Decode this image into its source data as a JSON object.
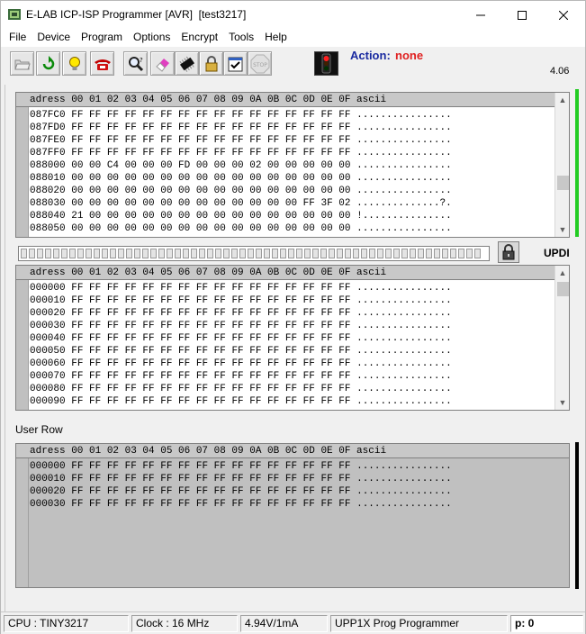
{
  "window": {
    "title": "E-LAB ICP-ISP Programmer [AVR]  [test3217]",
    "minimize_glyph": "—",
    "maximize_glyph": "☐",
    "close_glyph": "✕"
  },
  "menu": [
    "File",
    "Device",
    "Program",
    "Options",
    "Encrypt",
    "Tools",
    "Help"
  ],
  "toolbar": {
    "buttons": [
      {
        "name": "open-icon"
      },
      {
        "name": "reload-icon"
      },
      {
        "name": "bulb-icon"
      },
      {
        "name": "phone-icon"
      },
      {
        "name": "search-icon"
      },
      {
        "name": "eraser-icon"
      },
      {
        "name": "chip-icon"
      },
      {
        "name": "lock-icon"
      },
      {
        "name": "verify-check-icon"
      },
      {
        "name": "stop-icon"
      }
    ],
    "stop_label": "STOP",
    "action_label": "Action:",
    "action_value": "none",
    "version": "4.06"
  },
  "flash_panel": {
    "header": "adress 00 01 02 03 04 05 06 07 08 09 0A 0B 0C 0D 0E 0F ascii",
    "rows": [
      {
        "addr": "087FC0",
        "bytes": "FF FF FF FF FF FF FF FF FF FF FF FF FF FF FF FF",
        "ascii": "................"
      },
      {
        "addr": "087FD0",
        "bytes": "FF FF FF FF FF FF FF FF FF FF FF FF FF FF FF FF",
        "ascii": "................"
      },
      {
        "addr": "087FE0",
        "bytes": "FF FF FF FF FF FF FF FF FF FF FF FF FF FF FF FF",
        "ascii": "................"
      },
      {
        "addr": "087FF0",
        "bytes": "FF FF FF FF FF FF FF FF FF FF FF FF FF FF FF FF",
        "ascii": "................"
      },
      {
        "addr": "088000",
        "bytes": "00 00 C4 00 00 00 FD 00 00 00 02 00 00 00 00 00",
        "ascii": "................"
      },
      {
        "addr": "088010",
        "bytes": "00 00 00 00 00 00 00 00 00 00 00 00 00 00 00 00",
        "ascii": "................"
      },
      {
        "addr": "088020",
        "bytes": "00 00 00 00 00 00 00 00 00 00 00 00 00 00 00 00",
        "ascii": "................"
      },
      {
        "addr": "088030",
        "bytes": "00 00 00 00 00 00 00 00 00 00 00 00 00 FF 3F 02",
        "ascii": "..............?."
      },
      {
        "addr": "088040",
        "bytes": "21 00 00 00 00 00 00 00 00 00 00 00 00 00 00 00",
        "ascii": "!..............."
      },
      {
        "addr": "088050",
        "bytes": "00 00 00 00 00 00 00 00 00 00 00 00 00 00 00 00",
        "ascii": "................"
      }
    ]
  },
  "interface": {
    "label": "UPDI"
  },
  "eeprom_panel": {
    "header": "adress 00 01 02 03 04 05 06 07 08 09 0A 0B 0C 0D 0E 0F ascii",
    "rows": [
      {
        "addr": "000000",
        "bytes": "FF FF FF FF FF FF FF FF FF FF FF FF FF FF FF FF",
        "ascii": "................"
      },
      {
        "addr": "000010",
        "bytes": "FF FF FF FF FF FF FF FF FF FF FF FF FF FF FF FF",
        "ascii": "................"
      },
      {
        "addr": "000020",
        "bytes": "FF FF FF FF FF FF FF FF FF FF FF FF FF FF FF FF",
        "ascii": "................"
      },
      {
        "addr": "000030",
        "bytes": "FF FF FF FF FF FF FF FF FF FF FF FF FF FF FF FF",
        "ascii": "................"
      },
      {
        "addr": "000040",
        "bytes": "FF FF FF FF FF FF FF FF FF FF FF FF FF FF FF FF",
        "ascii": "................"
      },
      {
        "addr": "000050",
        "bytes": "FF FF FF FF FF FF FF FF FF FF FF FF FF FF FF FF",
        "ascii": "................"
      },
      {
        "addr": "000060",
        "bytes": "FF FF FF FF FF FF FF FF FF FF FF FF FF FF FF FF",
        "ascii": "................"
      },
      {
        "addr": "000070",
        "bytes": "FF FF FF FF FF FF FF FF FF FF FF FF FF FF FF FF",
        "ascii": "................"
      },
      {
        "addr": "000080",
        "bytes": "FF FF FF FF FF FF FF FF FF FF FF FF FF FF FF FF",
        "ascii": "................"
      },
      {
        "addr": "000090",
        "bytes": "FF FF FF FF FF FF FF FF FF FF FF FF FF FF FF FF",
        "ascii": "................"
      }
    ]
  },
  "user_row": {
    "label": "User Row",
    "header": "adress 00 01 02 03 04 05 06 07 08 09 0A 0B 0C 0D 0E 0F ascii",
    "rows": [
      {
        "addr": "000000",
        "bytes": "FF FF FF FF FF FF FF FF FF FF FF FF FF FF FF FF",
        "ascii": "................"
      },
      {
        "addr": "000010",
        "bytes": "FF FF FF FF FF FF FF FF FF FF FF FF FF FF FF FF",
        "ascii": "................"
      },
      {
        "addr": "000020",
        "bytes": "FF FF FF FF FF FF FF FF FF FF FF FF FF FF FF FF",
        "ascii": "................"
      },
      {
        "addr": "000030",
        "bytes": "FF FF FF FF FF FF FF FF FF FF FF FF FF FF FF FF",
        "ascii": "................"
      }
    ]
  },
  "statusbar": {
    "cpu": "CPU : TINY3217",
    "clock": "Clock : 16 MHz",
    "power": "4.94V/1mA",
    "programmer": "UPP1X Prog Programmer",
    "page": "p: 0"
  }
}
